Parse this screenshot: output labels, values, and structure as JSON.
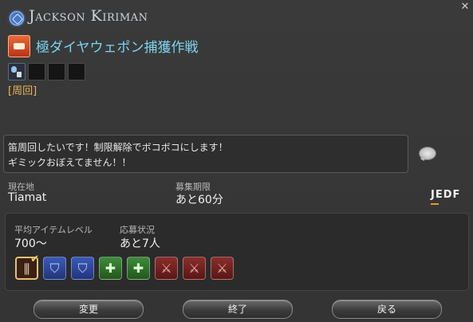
{
  "header": {
    "player_name": "Jackson Kiriman",
    "duty_title": "極ダイヤウェポン捕獲作戦",
    "close_label": "✕"
  },
  "party_slots": {
    "filled": 1,
    "total": 4
  },
  "tag": "[周回]",
  "comment": {
    "line1": "笛周回したいです！制限解除でボコボコにします！",
    "line2": "ギミックおぼえてません！！"
  },
  "location": {
    "label": "現在地",
    "value": "Tiamat"
  },
  "recruit_time": {
    "label": "募集期限",
    "value": "あと60分"
  },
  "languages": "JEDF",
  "requirements": {
    "avg_item_level_label": "平均アイテムレベル",
    "avg_item_level_value": "700〜",
    "status_label": "応募状況",
    "status_value": "あと7人"
  },
  "jobs": [
    {
      "role": "selected",
      "icon": "bard-icon"
    },
    {
      "role": "tank",
      "icon": "tank-shield-icon"
    },
    {
      "role": "tank",
      "icon": "tank-shield-icon"
    },
    {
      "role": "healer",
      "icon": "healer-cross-icon"
    },
    {
      "role": "healer",
      "icon": "healer-cross-icon"
    },
    {
      "role": "dps",
      "icon": "dps-sword-icon"
    },
    {
      "role": "dps",
      "icon": "dps-sword-icon"
    },
    {
      "role": "dps",
      "icon": "dps-sword-icon"
    }
  ],
  "buttons": {
    "change": "変更",
    "end": "終了",
    "back": "戻る"
  },
  "colors": {
    "duty_title": "#7cd4f0",
    "tag": "#e6b45a",
    "lang_accent": "#e0a020",
    "tank": "#3a59b8",
    "healer": "#3f8c3a",
    "dps": "#8a2e2a"
  }
}
